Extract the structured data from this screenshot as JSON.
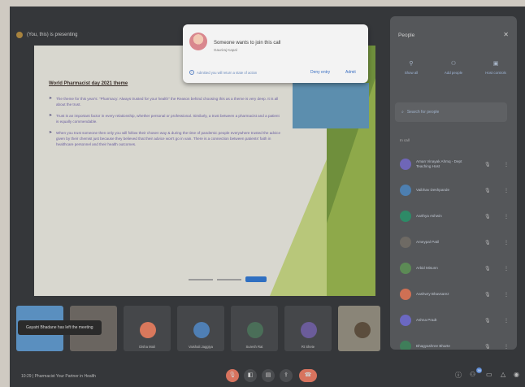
{
  "presenter": {
    "label": "(You, this) is presenting"
  },
  "slide": {
    "title": "World Pharmacist day 2021 theme",
    "bullets": [
      "The theme for this year's: \"Pharmacy: Always trusted for your health\" the Reason behind choosing this as a theme is very deep. It is all about the trust.",
      "Trust is an important factor in every relationship, whether personal or professional. Similarly, a trust between a pharmacist and a patient is equally commendable.",
      "When you trust someone then only you will follow their chosen way & during the time of pandemic people everywhere trusted the advice given by their chemist just because they believed that their advice won't go in vain. There is a connection between patients' faith in healthcare personnel and their health outcomes."
    ]
  },
  "join_request": {
    "title": "Someone wants to join this call",
    "name": "Gauriraj Kapal",
    "note": "Admitted you will return a state of action",
    "deny_label": "Deny entry",
    "admit_label": "Admit"
  },
  "people": {
    "title": "People",
    "actions": [
      {
        "label": "Show all",
        "icon": "person-add-icon"
      },
      {
        "label": "Add people",
        "icon": "group-icon"
      },
      {
        "label": "Host controls",
        "icon": "shield-icon"
      }
    ],
    "search_placeholder": "Search for people",
    "section_label": "In call",
    "participants": [
      {
        "name": "Aman Vinayak Ahmq - Dept Teaching Host",
        "color": "#6f66b8"
      },
      {
        "name": "Vaibhav Deshpande",
        "color": "#4d7fb0"
      },
      {
        "name": "Aarthya Ashwin",
        "color": "#2e8a67"
      },
      {
        "name": "Ameypal Patil",
        "color": "#6e6a64"
      },
      {
        "name": "Arbid Misunn",
        "color": "#5c8a55"
      },
      {
        "name": "Aashwry Bhavsarez",
        "color": "#cf7054"
      },
      {
        "name": "Ashna Pradt",
        "color": "#6b68c2"
      },
      {
        "name": "Bhagyashree Bharte",
        "color": "#3f7e5a"
      }
    ]
  },
  "tiles": [
    {
      "name": "",
      "color": "#5a8fbf",
      "bubble": "#5a8fbf"
    },
    {
      "name": "",
      "color": "#6a6560",
      "bubble": "#6a6560"
    },
    {
      "name": "Disha Mali",
      "color": "#45474a",
      "bubble": "#d9785c"
    },
    {
      "name": "Vaishali Jaggiya",
      "color": "#45474a",
      "bubble": "#4f7fb4"
    },
    {
      "name": "Suresh Rat",
      "color": "#45474a",
      "bubble": "#4a6e58"
    },
    {
      "name": "Rt Shete",
      "color": "#45474a",
      "bubble": "#6b5c9a"
    },
    {
      "name": "",
      "color": "#8a8578",
      "bubble": "#5b4d3d"
    }
  ],
  "toast": "Gayatri Bhadane has left the meeting",
  "bottom": {
    "time_title": "10:29 | Pharmacist Your Partner in Health",
    "participant_count": "38"
  }
}
